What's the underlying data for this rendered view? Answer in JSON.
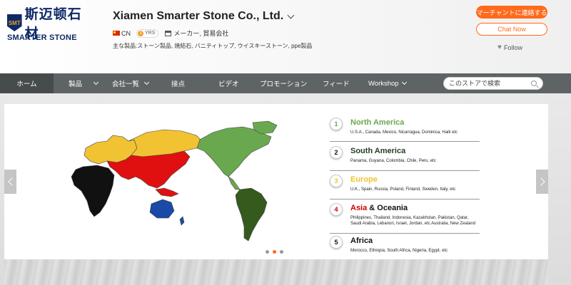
{
  "header": {
    "logo": {
      "cn": "斯迈顿石材",
      "en": "SMARTER STONE",
      "mark": "SMT"
    },
    "company_name": "Xiamen Smarter Stone Co., Ltd.",
    "country": "CN",
    "years": "3",
    "years_suffix": "YRS",
    "business_type": "メーカー, 貿易会社",
    "main_products": "主な製品:ストーン製品, 焼結石, バニティトップ, ウイスキーストーン, ppe製品",
    "contact_button": "マーチャントに連絡する",
    "chat_button": "Chat Now",
    "follow": "Follow"
  },
  "nav": {
    "items": [
      {
        "label": "ホーム",
        "active": true
      },
      {
        "label": "製品",
        "dropdown": true
      },
      {
        "label": "会社一覧",
        "dropdown": true
      },
      {
        "label": "接点"
      },
      {
        "label": "ビデオ"
      },
      {
        "label": "プロモーション"
      },
      {
        "label": "フィード"
      },
      {
        "label": "Workshop",
        "dropdown": true
      }
    ],
    "search_placeholder": "このストアで検索"
  },
  "banner": {
    "regions": [
      {
        "num": "1",
        "name": "North America",
        "name_color": "#6aa84f",
        "countries": "U.S.A., Canada, Mexico, Nicarragua, Dominica, Haiti etc"
      },
      {
        "num": "2",
        "name": "South America",
        "name_color": "#1f3d1f",
        "countries": "Panama, Guyana, Colombia, Chile, Peru, etc"
      },
      {
        "num": "3",
        "name": "Europe",
        "name_color": "#f1c232",
        "countries": "U.K., Spain, Russia, Poland, Finland, Sweden, Italy, etc"
      },
      {
        "num": "4",
        "name_part1": "Asia",
        "name_part2": " & Oceania",
        "name_color": "#cc0000",
        "countries": "Philippines, Thailand, Indonesia, Kazakhstan, Pakistan, Qatar, Saudi Arabia, Lebanon, Israel, Jordan, etc Australia, New Zealand"
      },
      {
        "num": "5",
        "name": "Africa",
        "name_color": "#111111",
        "countries": "Morocco, Ethiopia, South Africa, Nigeria, Egypt, etc"
      }
    ],
    "slide_count": 3,
    "active_slide": 1
  },
  "colors": {
    "accent": "#ff6a1c",
    "nav_bg": "#5e6465",
    "nav_active": "#464b4c",
    "brand": "#0d2a66"
  }
}
